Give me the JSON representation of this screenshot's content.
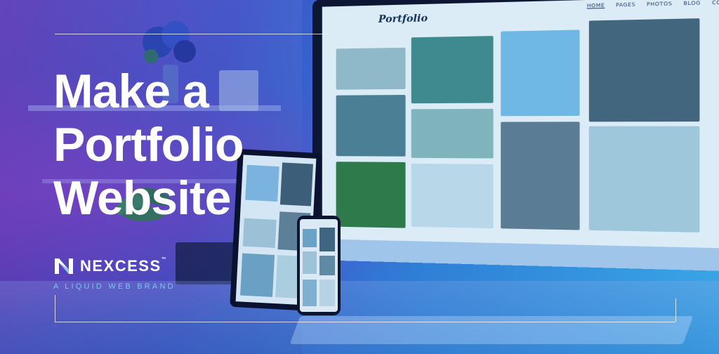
{
  "headline": {
    "line1": "Make a",
    "line2": "Portfolio",
    "line3": "Website"
  },
  "brand": {
    "name": "NEXCESS",
    "tm": "™",
    "tagline": "A LIQUID WEB BRAND",
    "accent_color": "#7ec5f0"
  },
  "monitor_site": {
    "logo": "Portfolio",
    "nav": [
      "HOME",
      "PAGES",
      "PHOTOS",
      "BLOG",
      "CONTACT"
    ]
  },
  "colors": {
    "gradient_left": "#5a3ab8",
    "gradient_right": "#39a6e6",
    "frame_line": "#ffffff"
  }
}
